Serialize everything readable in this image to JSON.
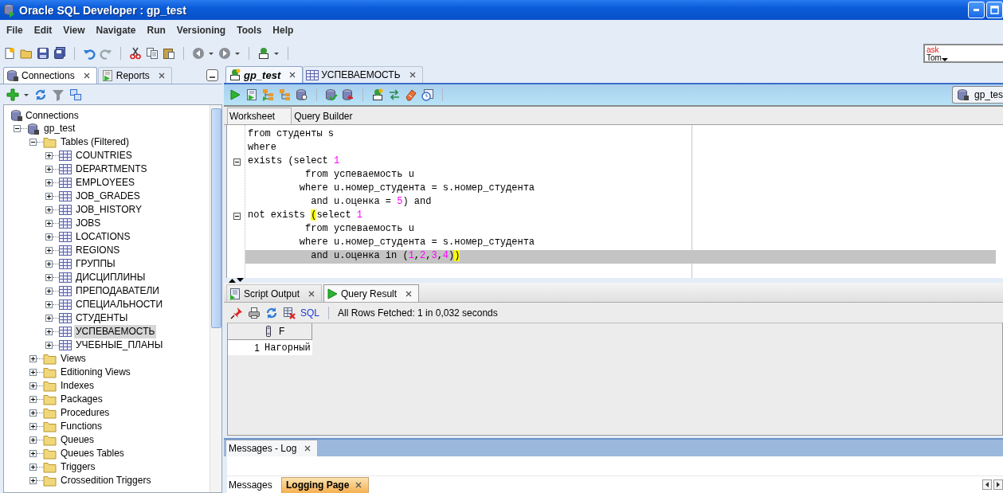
{
  "window": {
    "title": "Oracle SQL Developer : gp_test"
  },
  "menu": [
    "File",
    "Edit",
    "View",
    "Navigate",
    "Run",
    "Versioning",
    "Tools",
    "Help"
  ],
  "ask_tom": {
    "line_1": "ask",
    "line_2": "Tom"
  },
  "navigator": {
    "tabs": [
      {
        "label": "Connections",
        "selected": true,
        "kind": "connections"
      },
      {
        "label": "Reports",
        "selected": false,
        "kind": "reports"
      }
    ],
    "tree": {
      "root": "Connections",
      "items": [
        {
          "label": "gp_test",
          "kind": "connection",
          "expanded": true,
          "selected": false,
          "children": [
            {
              "label": "Tables (Filtered)",
              "kind": "folder",
              "expanded": true,
              "selected": false,
              "children": [
                {
                  "label": "COUNTRIES",
                  "kind": "table",
                  "expanded": false,
                  "selected": false
                },
                {
                  "label": "DEPARTMENTS",
                  "kind": "table",
                  "expanded": false,
                  "selected": false
                },
                {
                  "label": "EMPLOYEES",
                  "kind": "table",
                  "expanded": false,
                  "selected": false
                },
                {
                  "label": "JOB_GRADES",
                  "kind": "table",
                  "expanded": false,
                  "selected": false
                },
                {
                  "label": "JOB_HISTORY",
                  "kind": "table",
                  "expanded": false,
                  "selected": false
                },
                {
                  "label": "JOBS",
                  "kind": "table",
                  "expanded": false,
                  "selected": false
                },
                {
                  "label": "LOCATIONS",
                  "kind": "table",
                  "expanded": false,
                  "selected": false
                },
                {
                  "label": "REGIONS",
                  "kind": "table",
                  "expanded": false,
                  "selected": false
                },
                {
                  "label": "ГРУППЫ",
                  "kind": "table",
                  "expanded": false,
                  "selected": false
                },
                {
                  "label": "ДИСЦИПЛИНЫ",
                  "kind": "table",
                  "expanded": false,
                  "selected": false
                },
                {
                  "label": "ПРЕПОДАВАТЕЛИ",
                  "kind": "table",
                  "expanded": false,
                  "selected": false
                },
                {
                  "label": "СПЕЦИАЛЬНОСТИ",
                  "kind": "table",
                  "expanded": false,
                  "selected": false
                },
                {
                  "label": "СТУДЕНТЫ",
                  "kind": "table",
                  "expanded": false,
                  "selected": false
                },
                {
                  "label": "УСПЕВАЕМОСТЬ",
                  "kind": "table",
                  "expanded": false,
                  "selected": true
                },
                {
                  "label": "УЧЕБНЫЕ_ПЛАНЫ",
                  "kind": "table",
                  "expanded": false,
                  "selected": false
                }
              ]
            },
            {
              "label": "Views",
              "kind": "folder",
              "expanded": false,
              "selected": false
            },
            {
              "label": "Editioning Views",
              "kind": "folder",
              "expanded": false,
              "selected": false
            },
            {
              "label": "Indexes",
              "kind": "folder",
              "expanded": false,
              "selected": false
            },
            {
              "label": "Packages",
              "kind": "folder",
              "expanded": false,
              "selected": false
            },
            {
              "label": "Procedures",
              "kind": "folder",
              "expanded": false,
              "selected": false
            },
            {
              "label": "Functions",
              "kind": "folder",
              "expanded": false,
              "selected": false
            },
            {
              "label": "Queues",
              "kind": "folder",
              "expanded": false,
              "selected": false
            },
            {
              "label": "Queues Tables",
              "kind": "folder",
              "expanded": false,
              "selected": false
            },
            {
              "label": "Triggers",
              "kind": "folder",
              "expanded": false,
              "selected": false
            },
            {
              "label": "Crossedition Triggers",
              "kind": "folder",
              "expanded": false,
              "selected": false
            }
          ]
        }
      ]
    }
  },
  "editor": {
    "tabs": [
      {
        "label": "gp_test",
        "selected": true,
        "kind": "worksheet"
      },
      {
        "label": "УСПЕВАЕМОСТЬ",
        "selected": false,
        "kind": "table"
      }
    ],
    "connection": "gp_tes",
    "subtabs": [
      {
        "label": "Worksheet",
        "selected": true
      },
      {
        "label": "Query Builder",
        "selected": false
      }
    ],
    "lines": [
      {
        "fold": false,
        "current": false,
        "segments": [
          {
            "text": "from студенты s",
            "kind": "code"
          }
        ]
      },
      {
        "fold": false,
        "current": false,
        "segments": [
          {
            "text": "where",
            "kind": "code"
          }
        ]
      },
      {
        "fold": true,
        "current": false,
        "segments": [
          {
            "text": "exists (select ",
            "kind": "code"
          },
          {
            "text": "1",
            "kind": "number"
          }
        ]
      },
      {
        "fold": false,
        "current": false,
        "segments": [
          {
            "text": "          from успеваемость u",
            "kind": "code"
          }
        ]
      },
      {
        "fold": false,
        "current": false,
        "segments": [
          {
            "text": "         where u.номер_студента = s.номер_студента",
            "kind": "code"
          }
        ]
      },
      {
        "fold": false,
        "current": false,
        "segments": [
          {
            "text": "           and u.оценка = ",
            "kind": "code"
          },
          {
            "text": "5",
            "kind": "number"
          },
          {
            "text": ") and",
            "kind": "code"
          }
        ]
      },
      {
        "fold": true,
        "current": false,
        "segments": [
          {
            "text": "not exists ",
            "kind": "code"
          },
          {
            "text": "(",
            "kind": "bracket"
          },
          {
            "text": "select ",
            "kind": "code"
          },
          {
            "text": "1",
            "kind": "number"
          }
        ]
      },
      {
        "fold": false,
        "current": false,
        "segments": [
          {
            "text": "          from успеваемость u",
            "kind": "code"
          }
        ]
      },
      {
        "fold": false,
        "current": false,
        "segments": [
          {
            "text": "         where u.номер_студента = s.номер_студента",
            "kind": "code"
          }
        ]
      },
      {
        "fold": false,
        "current": true,
        "segments": [
          {
            "text": "           and u.оценка in (",
            "kind": "code"
          },
          {
            "text": "1",
            "kind": "number"
          },
          {
            "text": ",",
            "kind": "code"
          },
          {
            "text": "2",
            "kind": "number"
          },
          {
            "text": ",",
            "kind": "code"
          },
          {
            "text": "3",
            "kind": "number"
          },
          {
            "text": ",",
            "kind": "code"
          },
          {
            "text": "4",
            "kind": "number"
          },
          {
            "text": ")",
            "kind": "code"
          },
          {
            "text": ")",
            "kind": "bracket"
          }
        ]
      }
    ]
  },
  "results": {
    "tabs": [
      {
        "label": "Script Output",
        "selected": false,
        "kind": "script"
      },
      {
        "label": "Query Result",
        "selected": true,
        "kind": "result"
      }
    ],
    "sql_link": "SQL",
    "status": "All Rows Fetched: 1 in 0,032 seconds",
    "columns": [
      "F"
    ],
    "rows": [
      {
        "number": "1",
        "cells": [
          "Нагорный"
        ]
      }
    ]
  },
  "log": {
    "title": "Messages - Log",
    "tabs": [
      {
        "label": "Messages",
        "selected": false,
        "closable": false
      },
      {
        "label": "Logging Page",
        "selected": true,
        "closable": true
      }
    ]
  }
}
